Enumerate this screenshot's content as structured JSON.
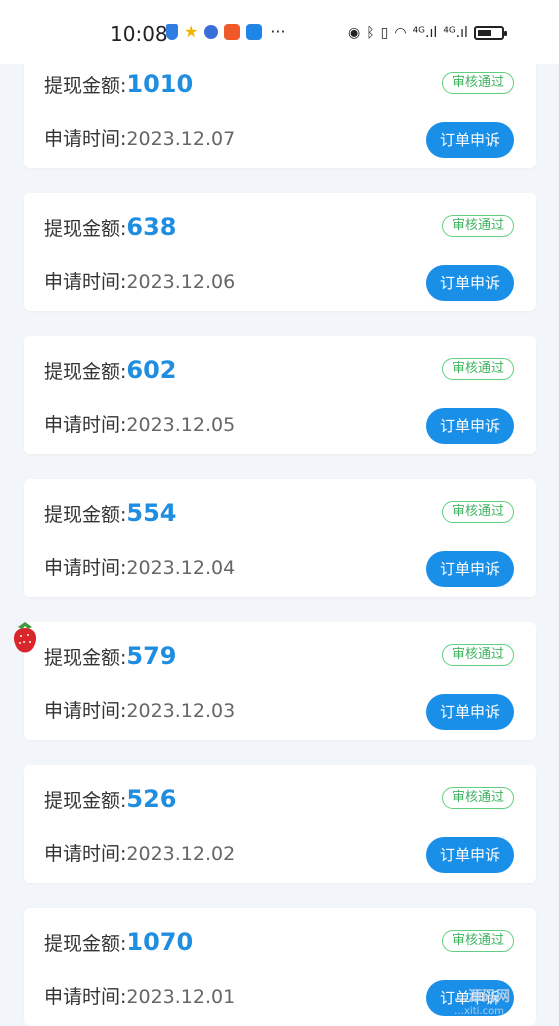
{
  "status_bar": {
    "time": "10:08",
    "dots": "···",
    "signal_1": "⁴ᴳ.ıl",
    "signal_2": "⁴ᴳ.ıl",
    "battery_level": 0.6,
    "left_icons": [
      "shield-icon",
      "star-icon",
      "globe-icon",
      "app-icon",
      "cloud-icon"
    ],
    "right_icons": [
      "eye-icon",
      "bluetooth-icon",
      "vibrate-icon",
      "wifi-icon",
      "signal-icon",
      "battery-icon"
    ]
  },
  "labels": {
    "amount": "提现金额:",
    "apply_time": "申请时间:",
    "status": "审核通过",
    "appeal": "订单申诉"
  },
  "records": [
    {
      "amount": "1010",
      "date": "2023.12.07"
    },
    {
      "amount": "638",
      "date": "2023.12.06"
    },
    {
      "amount": "602",
      "date": "2023.12.05"
    },
    {
      "amount": "554",
      "date": "2023.12.04"
    },
    {
      "amount": "579",
      "date": "2023.12.03"
    },
    {
      "amount": "526",
      "date": "2023.12.02"
    },
    {
      "amount": "1070",
      "date": "2023.12.01"
    }
  ],
  "colors": {
    "accent": "#1a8fe8",
    "amount": "#1f8ee0",
    "status_green": "#3db35f",
    "background": "#f2f5f9"
  },
  "watermark": {
    "main": "…源码网",
    "sub": "…xiti.com"
  }
}
